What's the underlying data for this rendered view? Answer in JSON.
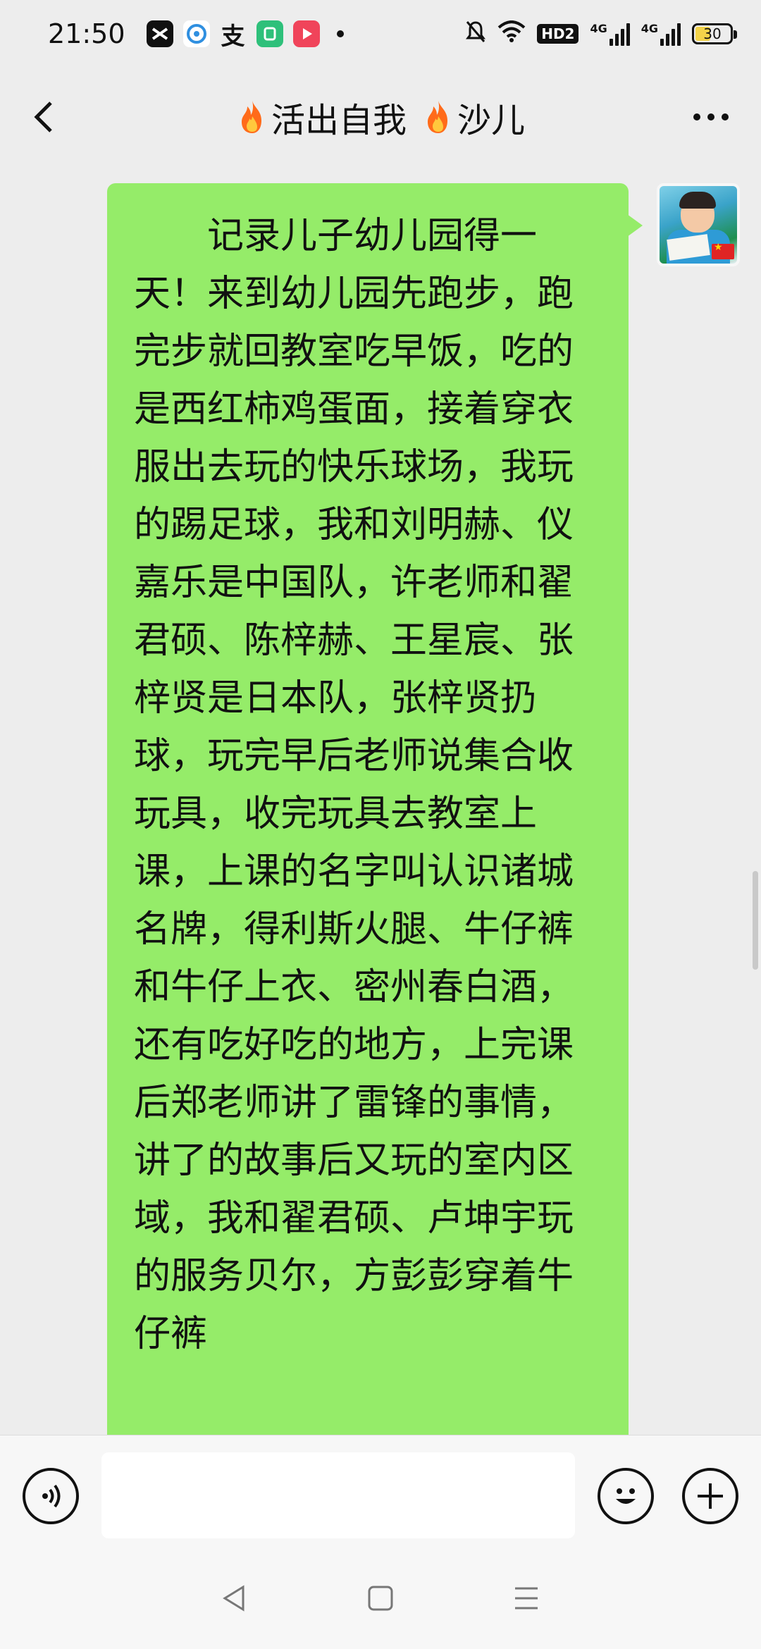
{
  "status_bar": {
    "time": "21:50",
    "hd_badge": "HD2",
    "network_1": "4G",
    "network_2": "4G",
    "battery": "30",
    "app_icons": [
      "capcut-icon",
      "browser-icon",
      "alipay-icon",
      "gamecenter-icon",
      "video-icon"
    ]
  },
  "header": {
    "title_part1": "活出自我",
    "title_part2": "沙儿",
    "title_icon": "fire-icon"
  },
  "message": {
    "sender": "self",
    "text": "记录儿子幼儿园得一天！来到幼儿园先跑步，跑完步就回教室吃早饭，吃的是西红柿鸡蛋面，接着穿衣服出去玩的快乐球场，我玩的踢足球，我和刘明赫、仪嘉乐是中国队，许老师和翟君硕、陈梓赫、王星宸、张梓贤是日本队，张梓贤扔球，玩完早后老师说集合收玩具，收完玩具去教室上课，上课的名字叫认识诸城名牌，得利斯火腿、牛仔裤和牛仔上衣、密州春白酒，还有吃好吃的地方，上完课后郑老师讲了雷锋的事情，讲了的故事后又玩的室内区域，我和翟君硕、卢坤宇玩的服务贝尔，方彭彭穿着牛仔裤",
    "bubble_color": "#95ec69"
  },
  "input_bar": {
    "value": "",
    "voice_icon": "voice-icon",
    "emoji_icon": "emoji-icon",
    "plus_icon": "plus-icon"
  },
  "colors": {
    "background": "#ededed",
    "bubble": "#95ec69",
    "bar": "#f7f7f7"
  }
}
